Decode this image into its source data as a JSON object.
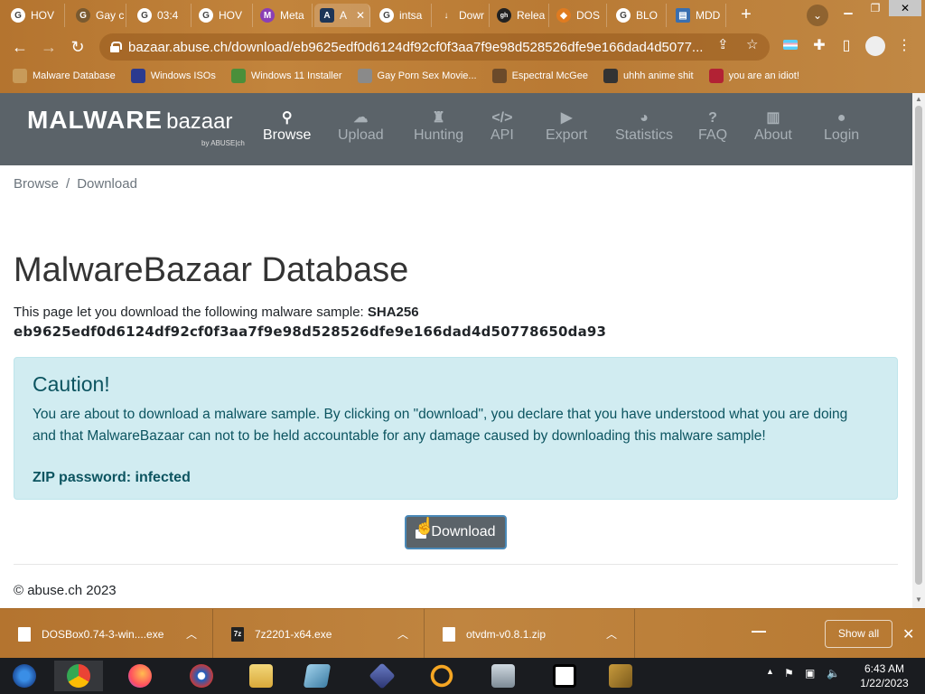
{
  "browser": {
    "tabs": [
      {
        "label": "HOV",
        "favicon": "G"
      },
      {
        "label": "Gay c",
        "favicon": "G"
      },
      {
        "label": "03:4",
        "favicon": "G"
      },
      {
        "label": "HOV",
        "favicon": "G"
      },
      {
        "label": "Meta",
        "favicon": "M"
      },
      {
        "label": "A",
        "favicon": "A",
        "active": true
      },
      {
        "label": "intsa",
        "favicon": "G"
      },
      {
        "label": "Dowr",
        "favicon": "↓"
      },
      {
        "label": "Relea",
        "favicon": "gh"
      },
      {
        "label": "DOS",
        "favicon": "◆"
      },
      {
        "label": "BLO",
        "favicon": "G"
      },
      {
        "label": "MDD",
        "favicon": "▤"
      }
    ],
    "url": "bazaar.abuse.ch/download/eb9625edf0d6124df92cf0f3aa7f9e98d528526dfe9e166dad4d5077...",
    "bookmarks": [
      {
        "label": "Malware Database",
        "color": "#c89b5a"
      },
      {
        "label": "Windows ISOs",
        "color": "#2b3a8f"
      },
      {
        "label": "Windows 11 Installer",
        "color": "#4a8f3a"
      },
      {
        "label": "Gay Porn Sex Movie...",
        "color": "#8a8a8a"
      },
      {
        "label": "Espectral McGee",
        "color": "#6b4a2a"
      },
      {
        "label": "uhhh anime shit",
        "color": "#333333"
      },
      {
        "label": "you are an idiot!",
        "color": "#b22234"
      }
    ]
  },
  "site": {
    "logo_main": "MALWARE",
    "logo_sub": "bazaar",
    "logo_by": "by ABUSE|ch",
    "nav": [
      {
        "label": "Browse",
        "icon": "search-icon",
        "glyph": "⚲",
        "active": true
      },
      {
        "label": "Upload",
        "icon": "cloud-upload-icon",
        "glyph": "☁"
      },
      {
        "label": "Hunting",
        "icon": "binoculars-icon",
        "glyph": "♜"
      },
      {
        "label": "API",
        "icon": "code-icon",
        "glyph": "</>"
      },
      {
        "label": "Export",
        "icon": "file-export-icon",
        "glyph": "▶"
      },
      {
        "label": "Statistics",
        "icon": "pie-chart-icon",
        "glyph": "◕"
      },
      {
        "label": "FAQ",
        "icon": "question-icon",
        "glyph": "?"
      },
      {
        "label": "About",
        "icon": "building-icon",
        "glyph": "▥"
      },
      {
        "label": "Login",
        "icon": "user-icon",
        "glyph": "●"
      }
    ]
  },
  "page": {
    "breadcrumb": {
      "home": "Browse",
      "sep": "/",
      "current": "Download"
    },
    "title": "MalwareBazaar Database",
    "intro": "This page let you download the following malware sample: ",
    "sha_label": "SHA256",
    "sha256": "eb9625edf0d6124df92cf0f3aa7f9e98d528526dfe9e166dad4d50778650da93",
    "alert": {
      "heading": "Caution!",
      "text": "You are about to download a malware sample. By clicking on \"download\", you declare that you have understood what you are doing and that MalwareBazaar can not to be held accountable for any damage caused by downloading this malware sample!",
      "password": "ZIP password: infected"
    },
    "download_label": "Download",
    "footer": "© abuse.ch 2023"
  },
  "downloads": {
    "items": [
      {
        "name": "DOSBox0.74-3-win....exe"
      },
      {
        "name": "7z2201-x64.exe"
      },
      {
        "name": "otvdm-v0.8.1.zip"
      }
    ],
    "show_all": "Show all"
  },
  "taskbar": {
    "time": "6:43 AM",
    "date": "1/22/2023"
  },
  "colors": {
    "nav_bg": "#5b6369",
    "alert_bg": "#d1ecf1",
    "alert_text": "#0c5460",
    "chrome": "#b97a34"
  }
}
